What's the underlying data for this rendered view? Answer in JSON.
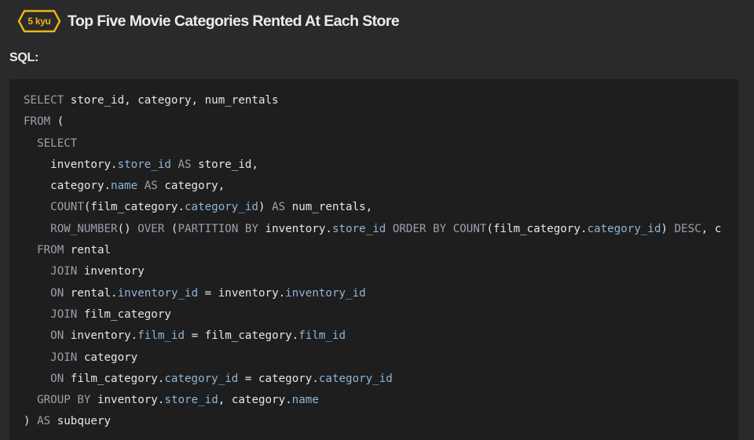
{
  "kata": {
    "rank_label": "5 kyu",
    "title": "Top Five Movie Categories Rented At Each Store",
    "accent_color": "#ecb613"
  },
  "solution": {
    "label": "SQL:"
  },
  "code": {
    "lines": [
      [
        {
          "t": "kw",
          "v": "SELECT"
        },
        {
          "t": "ident",
          "v": " store_id, category, num_rentals"
        }
      ],
      [
        {
          "t": "kw",
          "v": "FROM"
        },
        {
          "t": "ident",
          "v": " ("
        }
      ],
      [
        {
          "t": "ident",
          "v": "  "
        },
        {
          "t": "kw",
          "v": "SELECT"
        }
      ],
      [
        {
          "t": "ident",
          "v": "    inventory."
        },
        {
          "t": "col",
          "v": "store_id"
        },
        {
          "t": "kw",
          "v": " AS"
        },
        {
          "t": "ident",
          "v": " store_id,"
        }
      ],
      [
        {
          "t": "ident",
          "v": "    category."
        },
        {
          "t": "col",
          "v": "name"
        },
        {
          "t": "kw",
          "v": " AS"
        },
        {
          "t": "ident",
          "v": " category,"
        }
      ],
      [
        {
          "t": "ident",
          "v": "    "
        },
        {
          "t": "fn",
          "v": "COUNT"
        },
        {
          "t": "ident",
          "v": "(film_category."
        },
        {
          "t": "col",
          "v": "category_id"
        },
        {
          "t": "ident",
          "v": ")"
        },
        {
          "t": "kw",
          "v": " AS"
        },
        {
          "t": "ident",
          "v": " num_rentals,"
        }
      ],
      [
        {
          "t": "ident",
          "v": "    "
        },
        {
          "t": "fn",
          "v": "ROW_NUMBER"
        },
        {
          "t": "ident",
          "v": "() "
        },
        {
          "t": "kw",
          "v": "OVER"
        },
        {
          "t": "ident",
          "v": " ("
        },
        {
          "t": "kw",
          "v": "PARTITION BY"
        },
        {
          "t": "ident",
          "v": " inventory."
        },
        {
          "t": "col",
          "v": "store_id"
        },
        {
          "t": "kw",
          "v": " ORDER BY"
        },
        {
          "t": "ident",
          "v": " "
        },
        {
          "t": "fn",
          "v": "COUNT"
        },
        {
          "t": "ident",
          "v": "(film_category."
        },
        {
          "t": "col",
          "v": "category_id"
        },
        {
          "t": "ident",
          "v": ") "
        },
        {
          "t": "kw",
          "v": "DESC"
        },
        {
          "t": "ident",
          "v": ", c"
        }
      ],
      [
        {
          "t": "ident",
          "v": "  "
        },
        {
          "t": "kw",
          "v": "FROM"
        },
        {
          "t": "ident",
          "v": " rental"
        }
      ],
      [
        {
          "t": "ident",
          "v": "    "
        },
        {
          "t": "kw",
          "v": "JOIN"
        },
        {
          "t": "ident",
          "v": " inventory"
        }
      ],
      [
        {
          "t": "ident",
          "v": "    "
        },
        {
          "t": "kw",
          "v": "ON"
        },
        {
          "t": "ident",
          "v": " rental."
        },
        {
          "t": "col",
          "v": "inventory_id"
        },
        {
          "t": "ident",
          "v": " = inventory."
        },
        {
          "t": "col",
          "v": "inventory_id"
        }
      ],
      [
        {
          "t": "ident",
          "v": "    "
        },
        {
          "t": "kw",
          "v": "JOIN"
        },
        {
          "t": "ident",
          "v": " film_category"
        }
      ],
      [
        {
          "t": "ident",
          "v": "    "
        },
        {
          "t": "kw",
          "v": "ON"
        },
        {
          "t": "ident",
          "v": " inventory."
        },
        {
          "t": "col",
          "v": "film_id"
        },
        {
          "t": "ident",
          "v": " = film_category."
        },
        {
          "t": "col",
          "v": "film_id"
        }
      ],
      [
        {
          "t": "ident",
          "v": "    "
        },
        {
          "t": "kw",
          "v": "JOIN"
        },
        {
          "t": "ident",
          "v": " category"
        }
      ],
      [
        {
          "t": "ident",
          "v": "    "
        },
        {
          "t": "kw",
          "v": "ON"
        },
        {
          "t": "ident",
          "v": " film_category."
        },
        {
          "t": "col",
          "v": "category_id"
        },
        {
          "t": "ident",
          "v": " = category."
        },
        {
          "t": "col",
          "v": "category_id"
        }
      ],
      [
        {
          "t": "ident",
          "v": "  "
        },
        {
          "t": "kw",
          "v": "GROUP BY"
        },
        {
          "t": "ident",
          "v": " inventory."
        },
        {
          "t": "col",
          "v": "store_id"
        },
        {
          "t": "ident",
          "v": ", category."
        },
        {
          "t": "col",
          "v": "name"
        }
      ],
      [
        {
          "t": "ident",
          "v": ") "
        },
        {
          "t": "kw",
          "v": "AS"
        },
        {
          "t": "ident",
          "v": " subquery"
        }
      ]
    ]
  }
}
